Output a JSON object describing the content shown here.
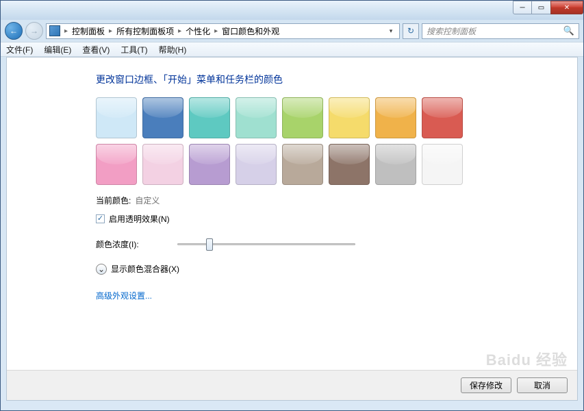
{
  "breadcrumb": [
    "控制面板",
    "所有控制面板项",
    "个性化",
    "窗口颜色和外观"
  ],
  "search_placeholder": "搜索控制面板",
  "menu": [
    "文件(F)",
    "编辑(E)",
    "查看(V)",
    "工具(T)",
    "帮助(H)"
  ],
  "page_title": "更改窗口边框、「开始」菜单和任务栏的颜色",
  "swatches": [
    {
      "name": "sky",
      "c": "#cfe8f7"
    },
    {
      "name": "blue",
      "c": "#4a7ebc"
    },
    {
      "name": "teal",
      "c": "#5ec9c1"
    },
    {
      "name": "aqua",
      "c": "#9fe0d0"
    },
    {
      "name": "lime",
      "c": "#a8d36a"
    },
    {
      "name": "yellow",
      "c": "#f5db6b"
    },
    {
      "name": "orange",
      "c": "#f0b24a"
    },
    {
      "name": "red",
      "c": "#d95b52"
    },
    {
      "name": "pink",
      "c": "#f29ec4"
    },
    {
      "name": "blush",
      "c": "#f3d1e3"
    },
    {
      "name": "violet",
      "c": "#b79cd1"
    },
    {
      "name": "lavender",
      "c": "#d6d0e8"
    },
    {
      "name": "taupe",
      "c": "#b8a99a"
    },
    {
      "name": "brown",
      "c": "#8d7468"
    },
    {
      "name": "grey",
      "c": "#bfbfbf"
    },
    {
      "name": "white",
      "c": "#f5f5f5"
    }
  ],
  "current_color_label": "当前颜色:",
  "current_color_value": "自定义",
  "transparency_label": "启用透明效果(N)",
  "transparency_checked": true,
  "intensity_label": "颜色浓度(I):",
  "intensity_value": 18,
  "mixer_label": "显示颜色混合器(X)",
  "advanced_link": "高级外观设置...",
  "buttons": {
    "save": "保存修改",
    "cancel": "取消"
  },
  "watermark": "Baidu 经验"
}
